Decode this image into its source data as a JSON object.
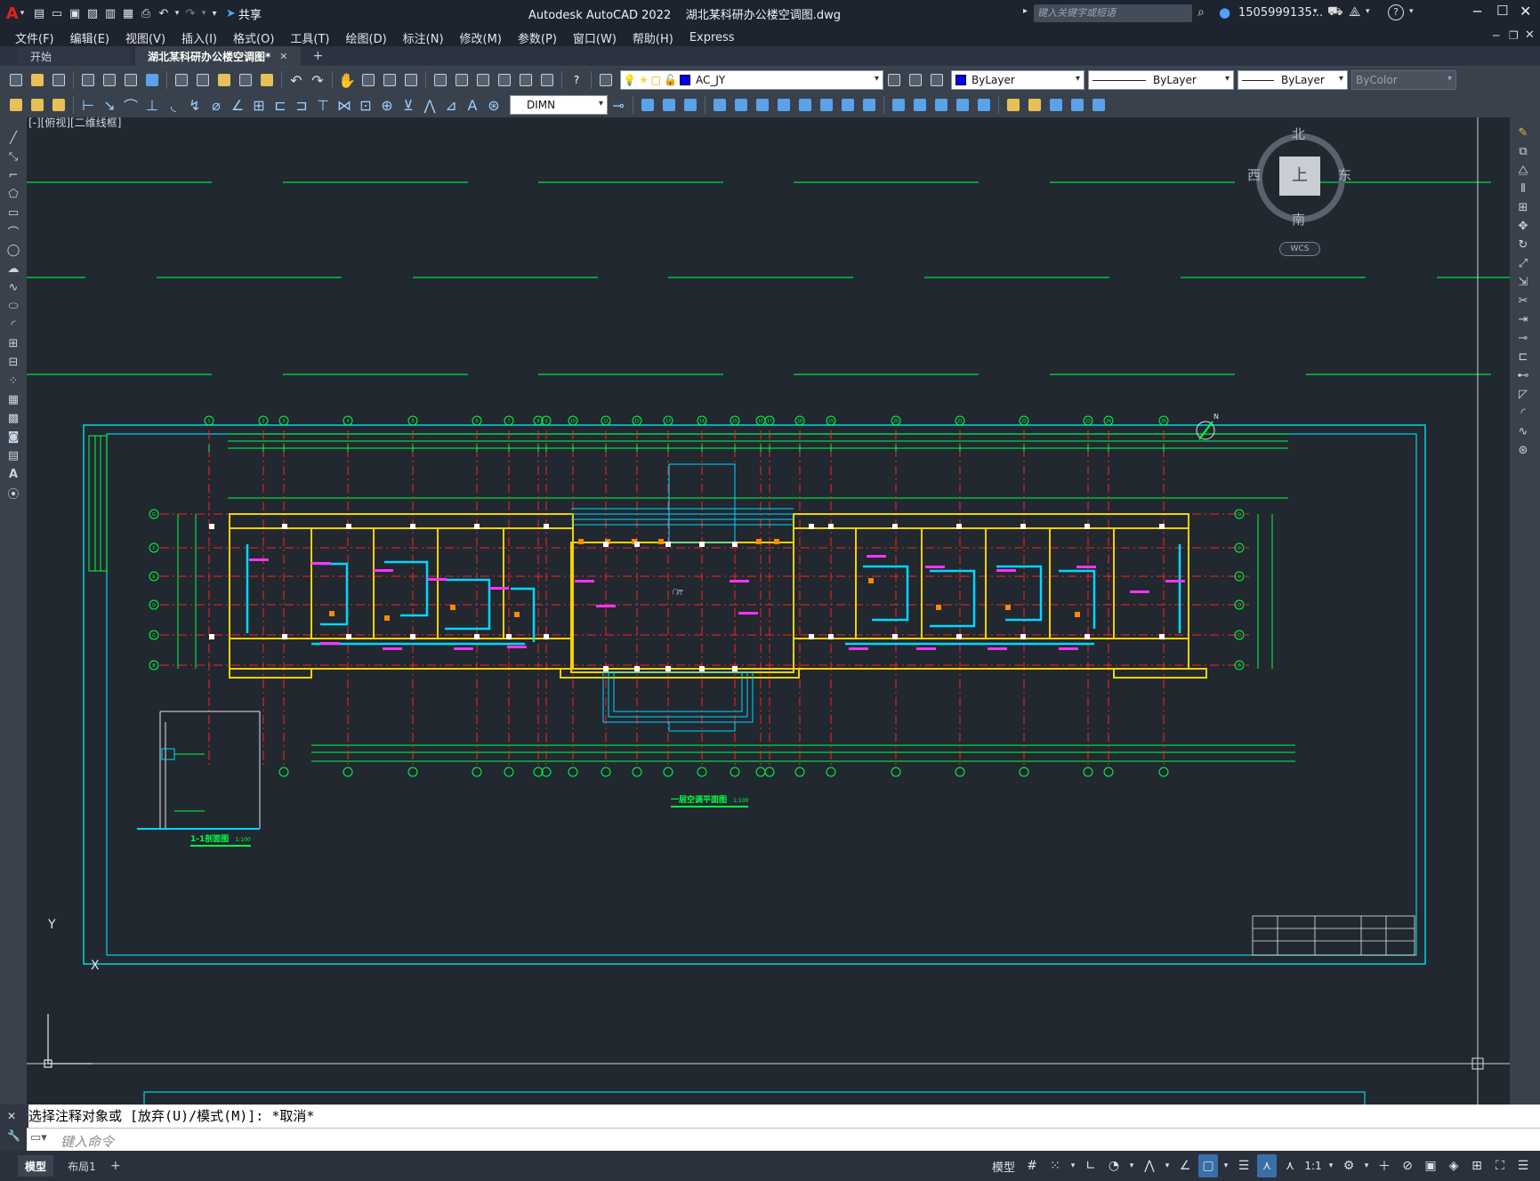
{
  "title_bar": {
    "app_logo": "A",
    "share_label": "共享",
    "title": "Autodesk AutoCAD 2022    湖北某科研办公楼空调图.dwg",
    "search_placeholder": "键入关键字或短语",
    "user": "1505999135...",
    "help": "?"
  },
  "menu": [
    "文件(F)",
    "编辑(E)",
    "视图(V)",
    "插入(I)",
    "格式(O)",
    "工具(T)",
    "绘图(D)",
    "标注(N)",
    "修改(M)",
    "参数(P)",
    "窗口(W)",
    "帮助(H)",
    "Express"
  ],
  "tabs": {
    "start": "开始",
    "file": "湖北某科研办公楼空调图*",
    "close": "✕",
    "add": "+"
  },
  "toolbar": {
    "layer": "AC_JY",
    "layer_color": "#0000ff",
    "color": "ByLayer",
    "linetype": "ByLayer",
    "lineweight": "ByLayer",
    "plotstyle": "ByColor",
    "dimstyle": "DIMN"
  },
  "viewport": {
    "label": "[-][俯视][二维线框]",
    "viewcube": {
      "north": "北",
      "south": "南",
      "east": "东",
      "west": "西",
      "top": "上",
      "wcs": "WCS"
    },
    "ucs": {
      "x": "X",
      "y": "Y"
    }
  },
  "drawing": {
    "plan_title": "一层空调平面图",
    "plan_scale": "1:100",
    "section_title": "1-1剖面图",
    "section_scale": "1:100",
    "north_label": "N",
    "center_room": "门厅",
    "grid_top": [
      "1",
      "2",
      "3",
      "4",
      "5",
      "6",
      "7",
      "8",
      "9",
      "10",
      "11",
      "12",
      "13",
      "14",
      "15",
      "16",
      "17",
      "18",
      "19",
      "20",
      "21",
      "22",
      "23",
      "24",
      "25"
    ],
    "grid_side": [
      "G",
      "F",
      "E",
      "D",
      "C",
      "B",
      "A"
    ]
  },
  "colors": {
    "canvas": "#212830",
    "wall": "#f2d200",
    "duct": "#00d8ff",
    "grid": "#00ff44",
    "axis": "#ff2222",
    "label": "#ff33ff",
    "frame": "#00d6e6",
    "white": "#ffffff"
  },
  "command": {
    "history": "选择注释对象或 [放弃(U)/模式(M)]: *取消*",
    "placeholder": "键入命令"
  },
  "status": {
    "tab_model": "模型",
    "tab_layout": "布局1",
    "add": "+",
    "model_label": "模型",
    "scale": "1:1"
  }
}
